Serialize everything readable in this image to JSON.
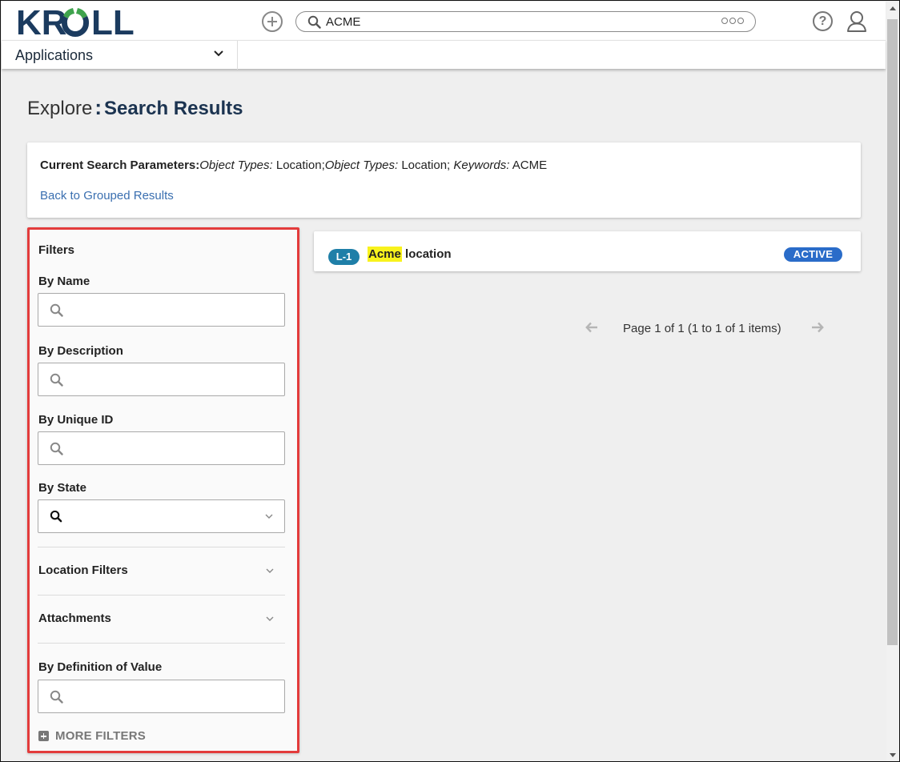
{
  "header": {
    "logo_text": "KROLL",
    "search_value": "ACME",
    "brand_color": "#1b3b5f",
    "accent_green": "#3fa34d"
  },
  "appbar": {
    "selected_app": "Applications"
  },
  "page": {
    "title_prefix": "Explore",
    "title_separator": ":",
    "title_main": "Search Results"
  },
  "params": {
    "label": "Current Search Parameters:",
    "obj_types_label_1": "Object Types:",
    "obj_types_value_1": "Location;",
    "obj_types_label_2": "Object Types:",
    "obj_types_value_2": "Location;",
    "keywords_label": "Keywords:",
    "keywords_value": "ACME",
    "back_link": "Back to Grouped Results"
  },
  "filters": {
    "title": "Filters",
    "by_name": "By Name",
    "by_description": "By Description",
    "by_unique_id": "By Unique ID",
    "by_state": "By State",
    "location_filters": "Location Filters",
    "attachments": "Attachments",
    "by_definition_of_value": "By Definition of Value",
    "more_filters": "MORE FILTERS",
    "highlight_border_color": "#e33b3b"
  },
  "results": [
    {
      "id": "L-1",
      "name_highlight": "Acme",
      "name_rest": " location",
      "status": "ACTIVE"
    }
  ],
  "pagination": {
    "text": "Page 1 of 1 (1 to 1 of 1 items)"
  },
  "icons": {
    "add": "plus-circle-icon",
    "search": "magnifier-icon",
    "more": "three-dots-icon",
    "help": "question-circle-icon",
    "user": "user-icon",
    "chevron": "chevron-down-icon",
    "prev": "arrow-left-icon",
    "next": "arrow-right-icon"
  },
  "help_glyph": "?"
}
